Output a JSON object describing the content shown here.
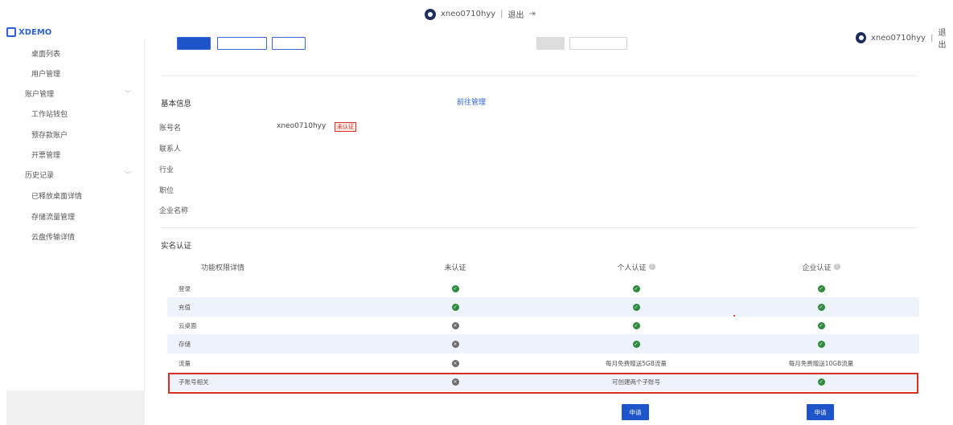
{
  "header": {
    "username": "xneo0710hyy",
    "logout_label": "退出",
    "separator": "|"
  },
  "brand": {
    "logo_text": "XDEMO"
  },
  "sidebar": {
    "items": [
      {
        "label": "桌面列表",
        "kind": "child"
      },
      {
        "label": "用户管理",
        "kind": "child"
      },
      {
        "label": "账户管理",
        "kind": "group"
      },
      {
        "label": "工作站钱包",
        "kind": "child"
      },
      {
        "label": "预存款账户",
        "kind": "child"
      },
      {
        "label": "开票管理",
        "kind": "child"
      },
      {
        "label": "历史记录",
        "kind": "group"
      },
      {
        "label": "已释放桌面详情",
        "kind": "child"
      },
      {
        "label": "存储流量管理",
        "kind": "child"
      },
      {
        "label": "云盘传输详情",
        "kind": "child"
      }
    ]
  },
  "basic_info": {
    "title": "基本信息",
    "manage_link": "前往管理",
    "account_label": "账号名",
    "account_value": "xneo0710hyy",
    "unverified_badge": "未认证",
    "contact_label": "联系人",
    "industry_label": "行业",
    "position_label": "职位",
    "company_label": "企业名称"
  },
  "verification": {
    "title": "实名认证",
    "columns": [
      "功能权限详情",
      "未认证",
      "个人认证",
      "企业认证"
    ],
    "rows": [
      {
        "feature": "登录",
        "unverified": "ok",
        "personal": "ok",
        "enterprise": "ok"
      },
      {
        "feature": "充值",
        "unverified": "ok",
        "personal": "ok",
        "enterprise": "ok"
      },
      {
        "feature": "云桌面",
        "unverified": "no",
        "personal": "ok",
        "enterprise": "ok"
      },
      {
        "feature": "存储",
        "unverified": "no",
        "personal": "ok",
        "enterprise": "ok"
      },
      {
        "feature": "流量",
        "unverified": "no",
        "personal": "每月免费赠送5GB流量",
        "enterprise": "每月免费赠送10GB流量"
      },
      {
        "feature": "子账号相关",
        "unverified": "no",
        "personal": "可创建两个子账号",
        "enterprise": "ok"
      }
    ],
    "apply_label": "申请"
  },
  "colors": {
    "accent": "#1d54c9",
    "success": "#2e8b3e",
    "danger": "#d93026"
  }
}
